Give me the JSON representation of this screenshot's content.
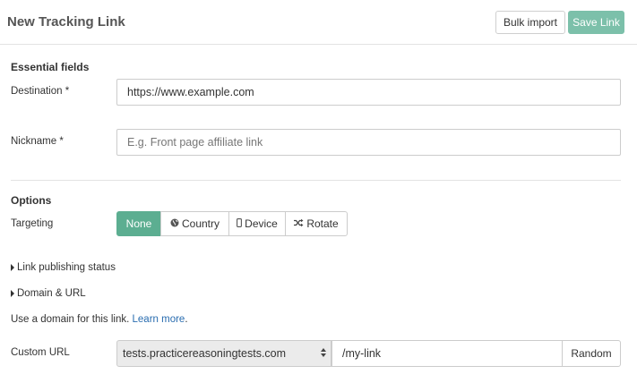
{
  "header": {
    "title": "New Tracking Link",
    "bulk_import_label": "Bulk import",
    "save_label": "Save Link"
  },
  "essential": {
    "title": "Essential fields",
    "destination_label": "Destination *",
    "destination_value": "https://www.example.com",
    "nickname_label": "Nickname *",
    "nickname_placeholder": "E.g. Front page affiliate link"
  },
  "options": {
    "title": "Options",
    "targeting_label": "Targeting",
    "targeting_buttons": [
      {
        "label": "None",
        "icon": "",
        "active": true
      },
      {
        "label": "Country",
        "icon": "globe-icon",
        "active": false
      },
      {
        "label": "Device",
        "icon": "mobile-icon",
        "active": false
      },
      {
        "label": "Rotate",
        "icon": "shuffle-icon",
        "active": false
      }
    ],
    "link_publishing_status": "Link publishing status",
    "domain_url": "Domain & URL"
  },
  "domain": {
    "help_text": "Use a domain for this link.",
    "learn_more": "Learn more",
    "help_suffix": ".",
    "custom_url_label": "Custom URL",
    "selected_domain": "tests.practicereasoningtests.com",
    "path_value": "/my-link",
    "random_label": "Random"
  },
  "colors": {
    "active_segment": "#5cae91",
    "save_button": "#7cc0aa",
    "link": "#2a6db0"
  }
}
